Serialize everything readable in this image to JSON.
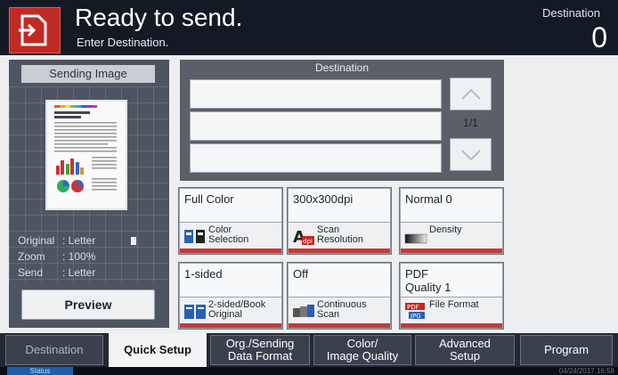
{
  "header": {
    "title": "Ready to send.",
    "subtitle": "Enter Destination.",
    "destination_label": "Destination",
    "destination_count": "0"
  },
  "sending_image": {
    "title": "Sending Image",
    "info": [
      {
        "key": "Original",
        "value": ": Letter"
      },
      {
        "key": "Zoom",
        "value": ": 100%"
      },
      {
        "key": "Send",
        "value": ": Letter"
      }
    ],
    "preview_button": "Preview"
  },
  "destination": {
    "title": "Destination",
    "page_indicator": "1/1"
  },
  "settings": [
    {
      "value": "Full Color",
      "label_line1": "Color",
      "label_line2": "Selection",
      "icon": "color-selection-icon"
    },
    {
      "value": "300x300dpi",
      "label_line1": "Scan",
      "label_line2": "Resolution",
      "icon": "scan-resolution-icon"
    },
    {
      "value": "Normal 0",
      "label_line1": "Density",
      "label_line2": "",
      "icon": "density-icon"
    },
    {
      "value": "1-sided",
      "label_line1": "2-sided/Book",
      "label_line2": "Original",
      "icon": "duplex-original-icon"
    },
    {
      "value": "Off",
      "label_line1": "Continuous",
      "label_line2": "Scan",
      "icon": "continuous-scan-icon"
    },
    {
      "value_line1": "PDF",
      "value_line2": "Quality 1",
      "label_line1": "File Format",
      "label_line2": "",
      "icon": "file-format-icon"
    }
  ],
  "tabs": [
    {
      "line1": "Destination",
      "line2": ""
    },
    {
      "line1": "Quick Setup",
      "line2": ""
    },
    {
      "line1": "Org./Sending",
      "line2": "Data Format"
    },
    {
      "line1": "Color/",
      "line2": "Image Quality"
    },
    {
      "line1": "Advanced",
      "line2": "Setup"
    },
    {
      "line1": "Program",
      "line2": ""
    }
  ],
  "status": {
    "button": "Status",
    "datetime": "04/24/2017 16:58"
  },
  "colors": {
    "accent_red": "#c02a24",
    "header_bg": "#141a24",
    "tab_active": "#f2f3f4",
    "status_blue": "#1f5fa8"
  }
}
